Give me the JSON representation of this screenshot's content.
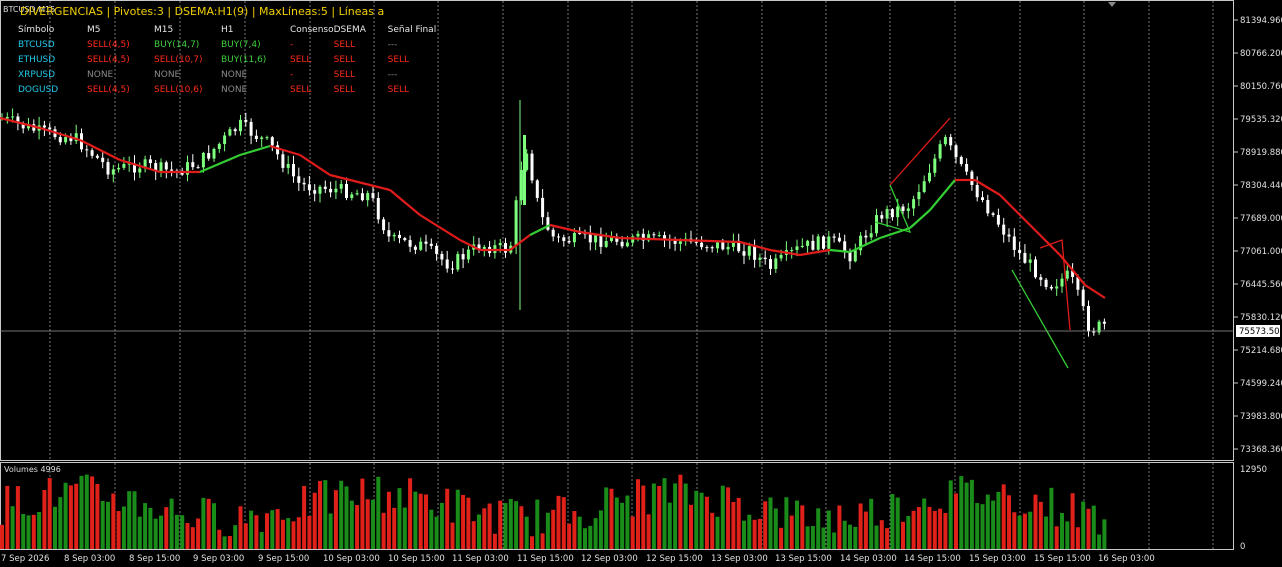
{
  "symbol_label": "BTCUSD,M15",
  "header": "DIVERGENCIAS | Pivotes:3 | DSEMA:H1(9) | MaxLíneas:5 | Líneas a",
  "table": {
    "columns": [
      "Símbolo",
      "M5",
      "M15",
      "H1",
      "Consenso",
      "DSEMA",
      "Señal Final"
    ],
    "rows": [
      {
        "symbol": "BTCUSD",
        "m5": "SELL(4,5)",
        "m15": "BUY(14,7)",
        "h1": "BUY(7,4)",
        "consenso": "-",
        "dsema": "SELL",
        "final": "---",
        "classes": [
          "cyan",
          "red",
          "green",
          "green",
          "red",
          "red",
          "grey"
        ]
      },
      {
        "symbol": "ETHUSD",
        "m5": "SELL(4,5)",
        "m15": "SELL(10,7)",
        "h1": "BUY(11,6)",
        "consenso": "SELL",
        "dsema": "SELL",
        "final": "SELL",
        "classes": [
          "cyan",
          "red",
          "red",
          "green",
          "red",
          "red",
          "red"
        ]
      },
      {
        "symbol": "XRPUSD",
        "m5": "NONE",
        "m15": "NONE",
        "h1": "NONE",
        "consenso": "-",
        "dsema": "SELL",
        "final": "---",
        "classes": [
          "cyan",
          "grey",
          "grey",
          "grey",
          "red",
          "red",
          "grey"
        ]
      },
      {
        "symbol": "DOGUSD",
        "m5": "SELL(4,5)",
        "m15": "SELL(10,6)",
        "h1": "NONE",
        "consenso": "SELL",
        "dsema": "SELL",
        "final": "SELL",
        "classes": [
          "cyan",
          "red",
          "red",
          "grey",
          "red",
          "red",
          "red"
        ]
      }
    ]
  },
  "price_axis": [
    "81394.960",
    "80766.200",
    "80150.760",
    "79535.320",
    "78919.880",
    "78304.440",
    "77689.000",
    "77061.000",
    "76445.560",
    "75830.120",
    "75214.680",
    "74599.240",
    "73983.800",
    "73368.360"
  ],
  "current_price": "75573.500",
  "volume_label": "Volumes 4996",
  "volume_axis": [
    "12950",
    "0"
  ],
  "time_axis": [
    "7 Sep 2026",
    "8 Sep 03:00",
    "8 Sep 15:00",
    "9 Sep 03:00",
    "9 Sep 15:00",
    "10 Sep 03:00",
    "10 Sep 15:00",
    "11 Sep 03:00",
    "11 Sep 15:00",
    "12 Sep 03:00",
    "12 Sep 15:00",
    "13 Sep 03:00",
    "13 Sep 15:00",
    "14 Sep 03:00",
    "14 Sep 15:00",
    "15 Sep 03:00",
    "15 Sep 15:00",
    "16 Sep 03:00"
  ],
  "colors": {
    "bull": "#7dff7d",
    "bear": "#ffffff",
    "volUp": "#1a8c1a",
    "volDown": "#e0211a",
    "dsemaRed": "#e21b1b",
    "dsemaGreen": "#33cc33"
  }
}
